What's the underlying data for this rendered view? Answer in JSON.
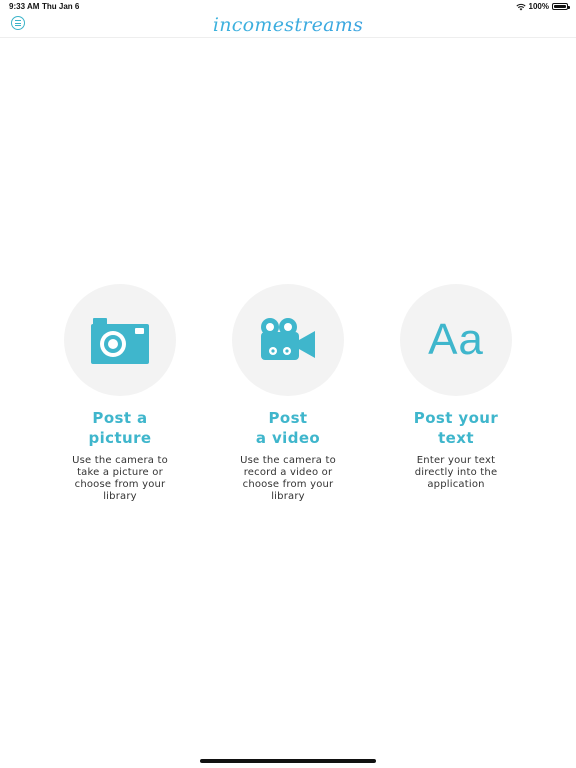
{
  "status_bar": {
    "time": "9:33 AM",
    "date": "Thu Jan 6",
    "battery": "100%",
    "battery_level": 1.0,
    "wifi_icon": "wifi-icon"
  },
  "header": {
    "logo_text": "incomestreams",
    "menu_icon": "hamburger-menu-icon",
    "accent_color": "#3fb6cc"
  },
  "options": [
    {
      "icon": "camera-icon",
      "title_line1": "Post a",
      "title_line2": "picture",
      "desc_line1": "Use the camera to",
      "desc_line2": "take a picture or",
      "desc_line3": "choose from your",
      "desc_line4": "library"
    },
    {
      "icon": "video-camera-icon",
      "title_line1": "Post",
      "title_line2": "a video",
      "desc_line1": "Use the camera to",
      "desc_line2": "record a video or",
      "desc_line3": "choose from your",
      "desc_line4": "library"
    },
    {
      "icon": "text-icon",
      "icon_text": "Aa",
      "title_line1": "Post your",
      "title_line2": "text",
      "desc_line1": "Enter your text",
      "desc_line2": "directly into the",
      "desc_line3": "application",
      "desc_line4": ""
    }
  ]
}
